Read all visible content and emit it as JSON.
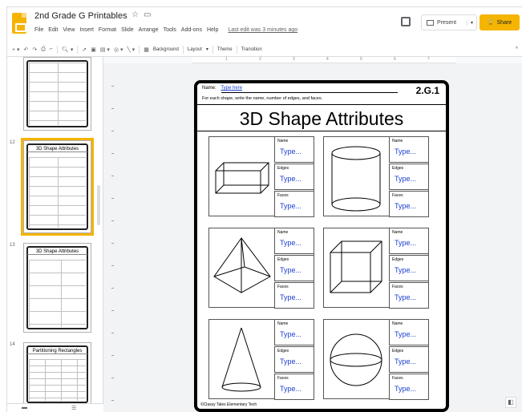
{
  "header": {
    "title": "2nd Grade G Printables",
    "star_icon": "star-icon",
    "folder_icon": "folder-icon",
    "menu": [
      "File",
      "Edit",
      "View",
      "Insert",
      "Format",
      "Slide",
      "Arrange",
      "Tools",
      "Add-ons",
      "Help"
    ],
    "last_edit": "Last edit was 3 minutes ago",
    "present_label": "Present",
    "share_label": "Share"
  },
  "toolbar": {
    "background_label": "Background",
    "layout_label": "Layout",
    "theme_label": "Theme",
    "transition_label": "Transition"
  },
  "ruler": [
    "1",
    "2",
    "3",
    "4",
    "5",
    "6",
    "7"
  ],
  "filmstrip": {
    "slides": [
      {
        "number": "",
        "title": ""
      },
      {
        "number": "12",
        "title": "3D Shape Attributes",
        "selected": true
      },
      {
        "number": "13",
        "title": "3D Shape Attributes"
      },
      {
        "number": "14",
        "title": "Partitioning Rectangles"
      }
    ]
  },
  "worksheet": {
    "name_label": "Name:",
    "name_value": "Type here",
    "code": "2.G.1",
    "instructions": "For each shape, write the name, number of edges, and faces.",
    "title": "3D Shape Attributes",
    "field_labels": [
      "Name",
      "Edges",
      "Faces"
    ],
    "field_value": "Type...",
    "shapes": [
      "rectangular-prism",
      "cylinder",
      "pyramid",
      "cube",
      "cone",
      "sphere"
    ],
    "copyright": "©Classy Tales Elementary Tech"
  },
  "colors": {
    "accent": "#f4b400",
    "field_text": "#1a3fd0"
  }
}
